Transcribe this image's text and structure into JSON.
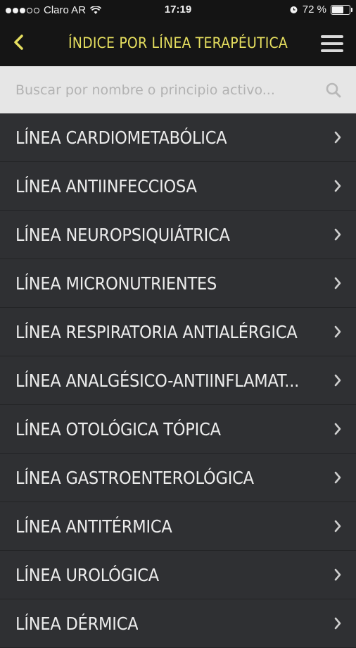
{
  "statusbar": {
    "carrier": "Claro AR",
    "time": "17:19",
    "battery_text": "72 %",
    "battery_level": 0.72
  },
  "header": {
    "title": "ÍNDICE POR LÍNEA TERAPÉUTICA",
    "accent_color": "#e6df5f",
    "back_icon": "chevron-left-icon",
    "menu_icon": "hamburger-menu-icon"
  },
  "search": {
    "placeholder": "Buscar por nombre o principio activo...",
    "value": ""
  },
  "list": {
    "items": [
      {
        "label": "LÍNEA CARDIOMETABÓLICA"
      },
      {
        "label": "LÍNEA ANTIINFECCIOSA"
      },
      {
        "label": "LÍNEA NEUROPSIQUIÁTRICA"
      },
      {
        "label": "LÍNEA MICRONUTRIENTES"
      },
      {
        "label": "LÍNEA RESPIRATORIA ANTIALÉRGICA"
      },
      {
        "label": "LÍNEA ANALGÉSICO-ANTIINFLAMAT..."
      },
      {
        "label": "LÍNEA OTOLÓGICA TÓPICA"
      },
      {
        "label": "LÍNEA GASTROENTEROLÓGICA"
      },
      {
        "label": "LÍNEA ANTITÉRMICA"
      },
      {
        "label": "LÍNEA UROLÓGICA"
      },
      {
        "label": "LÍNEA DÉRMICA"
      }
    ]
  }
}
